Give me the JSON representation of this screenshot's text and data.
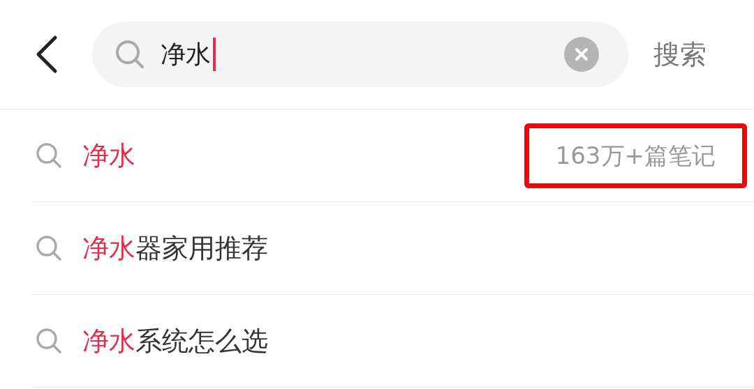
{
  "search_bar": {
    "query": "净水",
    "submit": "搜索"
  },
  "suggestions": [
    {
      "parts": [
        {
          "text": "净水",
          "matched": true
        }
      ],
      "count": "163万+篇笔记",
      "highlighted": true
    },
    {
      "parts": [
        {
          "text": "净水",
          "matched": true
        },
        {
          "text": "器家用推荐",
          "matched": false
        }
      ],
      "highlighted": false
    },
    {
      "parts": [
        {
          "text": "净水",
          "matched": true
        },
        {
          "text": "系统怎么选",
          "matched": false
        }
      ],
      "highlighted": false
    }
  ]
}
